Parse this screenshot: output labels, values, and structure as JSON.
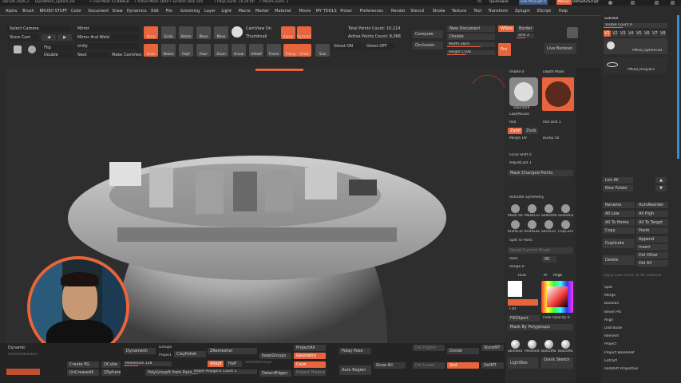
{
  "title_bar": {
    "app_version": "ZBrush 2026.2",
    "doc_name": "DynaMesh_Sphere_64",
    "free_mem": "• Free Mem 52.888GB",
    "active_mem": "• Active Mem 1840",
    "scratch_disk": "• Scratch Disk 105",
    "poly_count": "• PolyCount• 10.24 KP",
    "mesh_count": "• MeshCount• 2",
    "ac_label": "AC",
    "quicksave": "QuickSave",
    "see_through": "See-through 0",
    "menus_btn": "Menus",
    "default_script": "DefaultZScript"
  },
  "menubar": [
    "Alpha",
    "Brush",
    "BRUSH STUFF",
    "Color",
    "Document",
    "Draw",
    "Dynamics",
    "Edit",
    "File",
    "Grooming",
    "Layer",
    "Light",
    "Macro",
    "Marker",
    "Material",
    "Movie",
    "MY TOOLS",
    "Picker",
    "Preferences",
    "Render",
    "Stencil",
    "Stroke",
    "Texture",
    "Tool",
    "Transform",
    "Zplugin",
    "ZScript",
    "Help"
  ],
  "colors": {
    "accent": "#e8643c",
    "bg": "#2b2b2b",
    "canvas": "#2e2e2e"
  },
  "shelf_left": {
    "select_camera": "Select Camera",
    "store_cam": "Store Cam",
    "mirror": "Mirror",
    "mirror_and_weld": "Mirror And Weld",
    "flip": "Flip",
    "unify": "Unify",
    "double": "Double",
    "next": "Next",
    "make_camview": "Make CamView"
  },
  "shelf_icons": [
    "Move",
    "Scale",
    "Rotate",
    "Move",
    "Move",
    "Scale",
    "Rotate",
    "Polyf",
    "Floor",
    "Zoom",
    "Actual",
    "AAHalf",
    "Frame",
    "Transp",
    "Ghost",
    "Solo",
    "Xpose",
    "Dynamic",
    "Pers",
    "Local",
    "LSym"
  ],
  "camview": {
    "on": "CamView On",
    "thumb": "Thumbnail"
  },
  "points": {
    "total": "Total Points Count: 10,114",
    "active": "Active Points Count: 8,066",
    "ghost_on": "Ghost ON",
    "ghost_off": "Ghost OFF"
  },
  "doc": {
    "compute": "Compute",
    "occlusion": "Occlusion",
    "new_document": "New Document",
    "double": "Double",
    "width": "Width 2824",
    "height": "Height 1508",
    "wsize": "WSize",
    "border": "Border",
    "spix": "SPix 3",
    "pro": "Pro",
    "live_boolean": "Live Boolean"
  },
  "mid": {
    "imbed": "Imbed 0",
    "depth_mask": "Depth Mask",
    "standard": "Standard",
    "lazy_mouse": "LazyMouse",
    "roll": "Roll",
    "roll_dist": "Roll Dist 1",
    "zadd": "Zadd",
    "zsub": "Zsub",
    "morph_uv": "Morph UV",
    "bump": "Bump 50",
    "focal_shift": "Focal Shift 0",
    "adjust_last": "AdjustLast 1",
    "mask_changed_points": "Mask Changed Points",
    "activate_symmetry": "Activate Symmetry",
    "brush_icons": [
      "Mask Sh",
      "MaskCur",
      "SelectRe",
      "SelectLa",
      "KnifeCur",
      "KnifeLas",
      "SliceCur",
      "ClipCurv"
    ],
    "split_to_parts": "Split To Parts",
    "reset_current_brush": "Reset Current Brush",
    "rock": "Rock",
    "rock_val": "00",
    "range": "Range 0",
    "rgb": "RGB",
    "m": "M",
    "mrgb": "Mrgb",
    "flat": "Flat",
    "fill_object": "FillObject",
    "fade_opacity": "Fade Opacity 0",
    "mask_by_polygroups": "Mask By Polygroups",
    "materials": [
      "SkinSha",
      "Polished",
      "BasicMa",
      "BasicMa"
    ],
    "lightbox": "LightBox",
    "quick_sketch": "Quick Sketch"
  },
  "right": {
    "subtool": "SubTool",
    "visible_count": "Visible Count 6",
    "versions": [
      "V1",
      "V2",
      "V3",
      "V4",
      "V5",
      "V6",
      "V7",
      "V8"
    ],
    "subtools": [
      "PM3D_Sphere3D",
      "PM3D_Ring3D1"
    ],
    "list_all": "List All",
    "new_folder": "New Folder",
    "rename": "Rename",
    "autoreorder": "AutoReorder",
    "all_low": "All Low",
    "all_high": "All High",
    "all_to_home": "All To Home",
    "all_to_target": "All To Target",
    "copy": "Copy",
    "paste": "Paste",
    "duplicate": "Duplicate",
    "append": "Append",
    "insert": "Insert",
    "delete": "Delete",
    "del_other": "Del Other",
    "del_all": "Del All",
    "apply_low_active": "Apply Low Active To All Subtools",
    "actions": [
      "Split",
      "Merge",
      "Boolean",
      "Bevel Pro",
      "Align",
      "Distribute",
      "Remesh",
      "Project",
      "Project BasRelief",
      "Extract",
      "Redshift Properties"
    ]
  },
  "bottom": {
    "dynamic": "Dynamic",
    "smooth_mutation": "SmoothMutation",
    "create_pg": "Create PG",
    "qcube": "QCube",
    "uncrease_all": "UnCreaseAll",
    "qsphere": "QSphere",
    "dynamesh": "Dynamesh",
    "groups": "Groups",
    "project": "Project",
    "resolution": "Resolution 128",
    "claypolish": "ClayPolish",
    "polygroupit": "PolyGroupIt from Paint",
    "zremesher": "ZRemesher",
    "adapt": "Adapt",
    "half": "Half",
    "target_polygons": "Target Polygons Count 5",
    "keepgroups": "KeepGroups",
    "smooth_groups": "SmoothGroups",
    "detect_edges": "DetectEdges",
    "project_all": "ProjectAll",
    "geometry": "Geometry",
    "color": "Color",
    "project_history": "Project History",
    "poly_pose": "Polay Pose",
    "auto_region": "Auto Region",
    "grow_all": "Grow All",
    "del_higher": "Del Higher",
    "del_lower": "Del Lower",
    "divide": "Divide",
    "smt": "Smt",
    "store_mt": "StoreMT",
    "del_mt": "DelMT"
  }
}
